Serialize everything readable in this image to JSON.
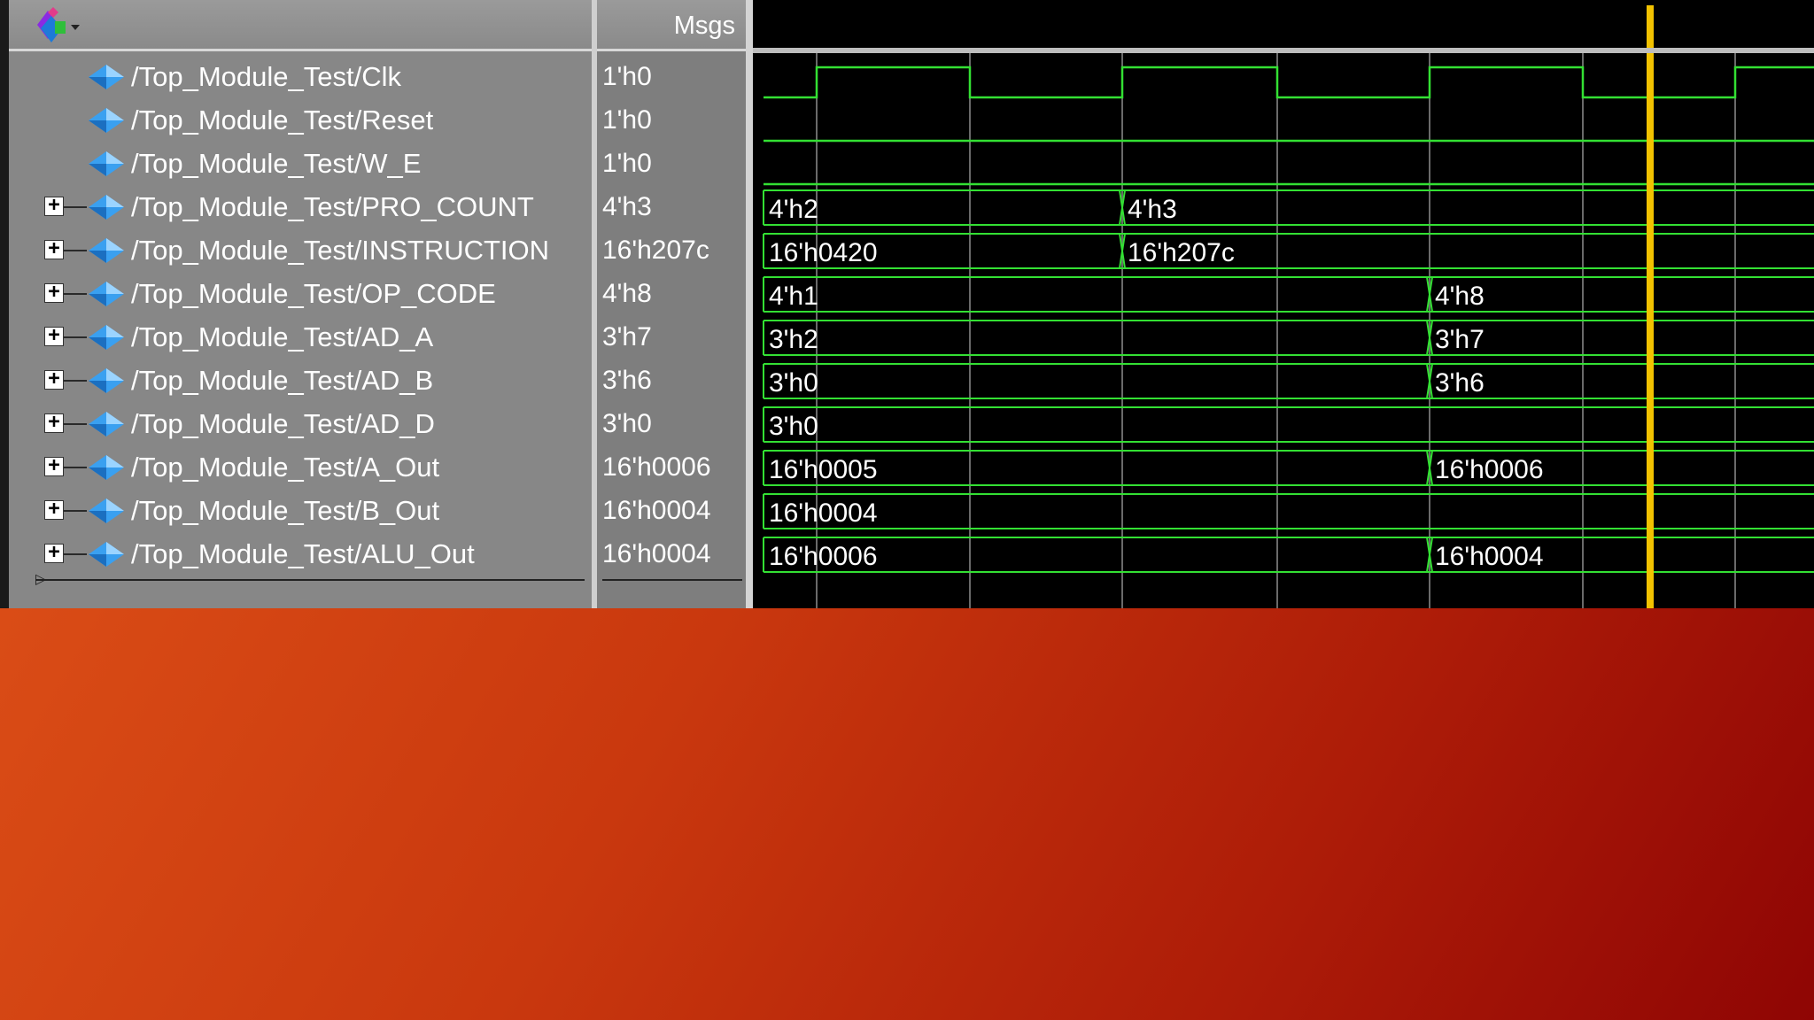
{
  "header": {
    "icon": "wave-signal-icon",
    "dropdown_icon": "chevron-down-icon",
    "msgs_label": "Msgs"
  },
  "signals": [
    {
      "name": "/Top_Module_Test/Clk",
      "value": "1'h0",
      "kind": "clock",
      "expandable": false
    },
    {
      "name": "/Top_Module_Test/Reset",
      "value": "1'h0",
      "kind": "low",
      "expandable": false
    },
    {
      "name": "/Top_Module_Test/W_E",
      "value": "1'h0",
      "kind": "low",
      "expandable": false
    },
    {
      "name": "/Top_Module_Test/PRO_COUNT",
      "value": "4'h3",
      "kind": "bus",
      "expandable": true,
      "segments": [
        {
          "label": "4'h2"
        },
        {
          "label": "4'h3",
          "at_edge": 2
        }
      ]
    },
    {
      "name": "/Top_Module_Test/INSTRUCTION",
      "value": "16'h207c",
      "kind": "bus",
      "expandable": true,
      "segments": [
        {
          "label": "16'h0420"
        },
        {
          "label": "16'h207c",
          "at_edge": 2
        }
      ]
    },
    {
      "name": "/Top_Module_Test/OP_CODE",
      "value": "4'h8",
      "kind": "bus",
      "expandable": true,
      "segments": [
        {
          "label": "4'h1"
        },
        {
          "label": "4'h8",
          "at_edge": 4
        }
      ]
    },
    {
      "name": "/Top_Module_Test/AD_A",
      "value": "3'h7",
      "kind": "bus",
      "expandable": true,
      "segments": [
        {
          "label": "3'h2"
        },
        {
          "label": "3'h7",
          "at_edge": 4
        }
      ]
    },
    {
      "name": "/Top_Module_Test/AD_B",
      "value": "3'h6",
      "kind": "bus",
      "expandable": true,
      "segments": [
        {
          "label": "3'h0"
        },
        {
          "label": "3'h6",
          "at_edge": 4
        }
      ]
    },
    {
      "name": "/Top_Module_Test/AD_D",
      "value": "3'h0",
      "kind": "bus",
      "expandable": true,
      "segments": [
        {
          "label": "3'h0"
        }
      ]
    },
    {
      "name": "/Top_Module_Test/A_Out",
      "value": "16'h0006",
      "kind": "bus",
      "expandable": true,
      "segments": [
        {
          "label": "16'h0005"
        },
        {
          "label": "16'h0006",
          "at_edge": 4
        }
      ]
    },
    {
      "name": "/Top_Module_Test/B_Out",
      "value": "16'h0004",
      "kind": "bus",
      "expandable": true,
      "segments": [
        {
          "label": "16'h0004"
        }
      ]
    },
    {
      "name": "/Top_Module_Test/ALU_Out",
      "value": "16'h0004",
      "kind": "bus",
      "expandable": true,
      "segments": [
        {
          "label": "16'h0006"
        },
        {
          "label": "16'h0004",
          "at_edge": 4
        }
      ]
    }
  ],
  "colors": {
    "wave": "#33e033",
    "grid": "#6a6a6a",
    "cursor": "#f2c200",
    "signal_icon": "#3aa0f0"
  }
}
